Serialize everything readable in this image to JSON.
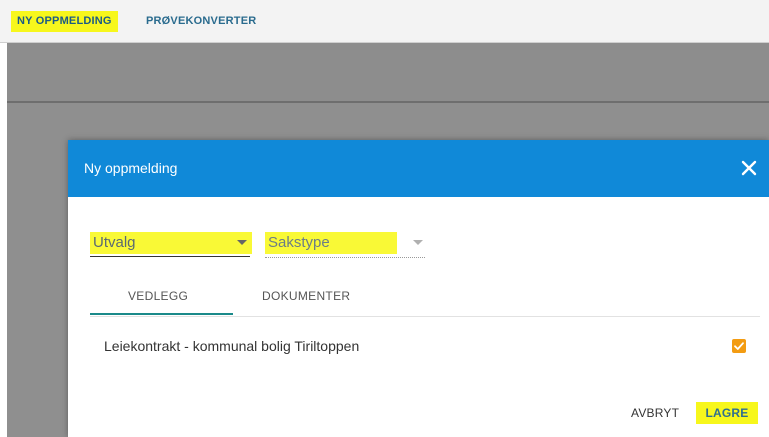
{
  "nav": {
    "tab_new": "NY OPPMELDING",
    "tab_converter": "PRØVEKONVERTER"
  },
  "dialog": {
    "title": "Ny oppmelding",
    "select_utvalg": "Utvalg",
    "select_sakstype": "Sakstype",
    "tabs": [
      {
        "label": "VEDLEGG",
        "active": true
      },
      {
        "label": "DOKUMENTER",
        "active": false
      }
    ],
    "attachment": {
      "label": "Leiekontrakt - kommunal bolig Tiriltoppen",
      "checked": true
    },
    "cancel_label": "AVBRYT",
    "save_label": "LAGRE"
  },
  "colors": {
    "header": "#1089d8",
    "highlight": "#f7f71c",
    "checkbox": "#f39c12",
    "tab_indicator": "#1a8a8a"
  },
  "icons": {
    "close": "close-icon",
    "dropdown": "chevron-down-icon",
    "check": "check-icon"
  }
}
